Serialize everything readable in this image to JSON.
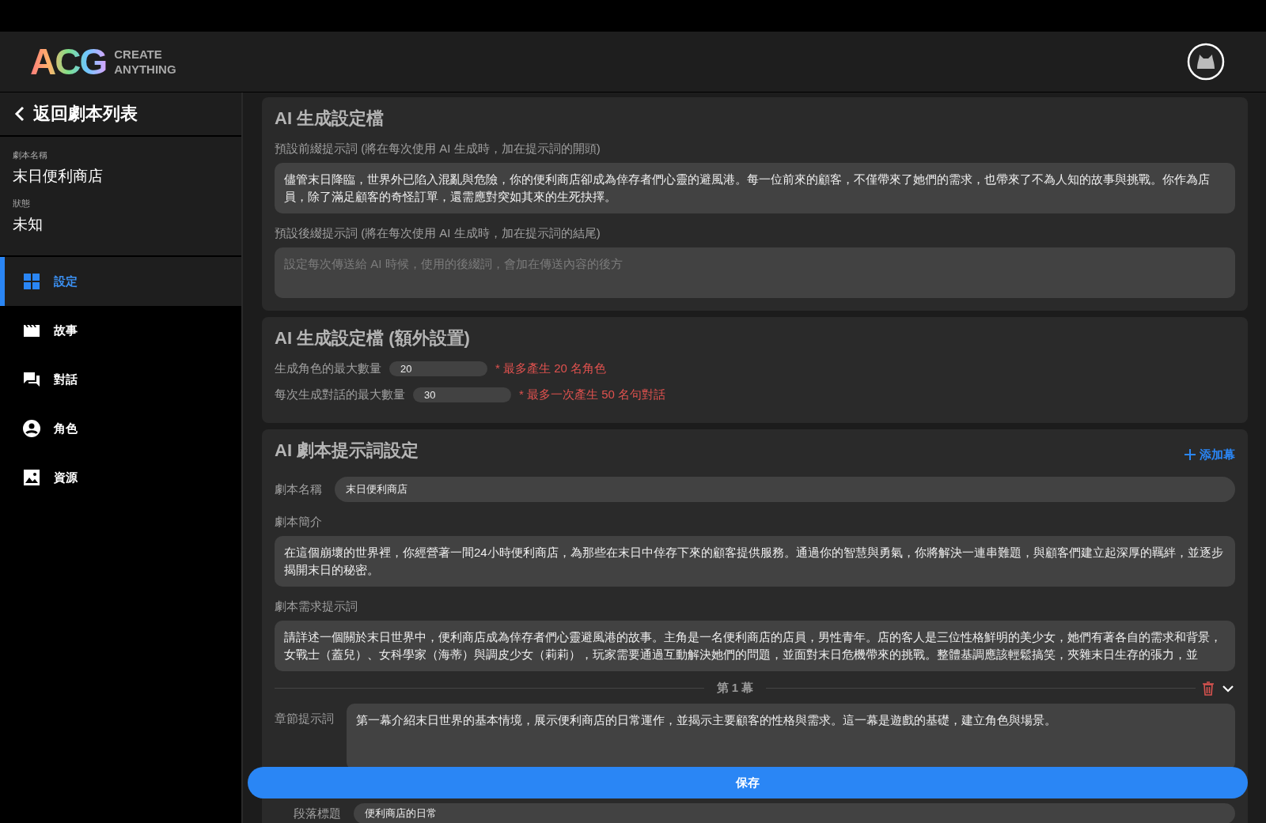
{
  "header": {
    "logo": "ACG",
    "tagline_1": "CREATE",
    "tagline_2": "ANYTHING"
  },
  "sidebar": {
    "back": "返回劇本列表",
    "info": [
      {
        "label": "劇本名稱",
        "value": "末日便利商店"
      },
      {
        "label": "狀態",
        "value": "未知"
      }
    ],
    "items": [
      {
        "kind": "grid",
        "label": "設定",
        "selected": true
      },
      {
        "kind": "film",
        "label": "故事",
        "selected": false
      },
      {
        "kind": "chat",
        "label": "對話",
        "selected": false
      },
      {
        "kind": "person",
        "label": "角色",
        "selected": false
      },
      {
        "kind": "image",
        "label": "資源",
        "selected": false
      }
    ]
  },
  "profile": {
    "title": "AI 生成設定檔",
    "prefix_label": "預設前綴提示詞 (將在每次使用 AI 生成時，加在提示詞的開頭)",
    "prefix_value": "儘管末日降臨，世界外已陷入混亂與危險，你的便利商店卻成為倖存者們心靈的避風港。每一位前來的顧客，不僅帶來了她們的需求，也帶來了不為人知的故事與挑戰。你作為店員，除了滿足顧客的奇怪訂單，還需應對突如其來的生死抉擇。",
    "suffix_label": "預設後綴提示詞 (將在每次使用 AI 生成時，加在提示詞的結尾)",
    "suffix_placeholder": "設定每次傳送給 AI 時候，使用的後綴詞，會加在傳送內容的後方"
  },
  "extra": {
    "title": "AI 生成設定檔 (額外設置)",
    "rows": [
      {
        "label": "生成角色的最大數量",
        "value": "20",
        "note": "* 最多產生 20 名角色"
      },
      {
        "label": "每次生成對話的最大數量",
        "value": "30",
        "note": "* 最多一次產生 50 名句對話"
      }
    ]
  },
  "script": {
    "title": "AI 劇本提示詞設定",
    "add": "添加幕",
    "name_label": "劇本名稱",
    "name_value": "末日便利商店",
    "intro_label": "劇本簡介",
    "intro_value": "在這個崩壞的世界裡，你經營著一間24小時便利商店，為那些在末日中倖存下來的顧客提供服務。通過你的智慧與勇氣，你將解決一連串難題，與顧客們建立起深厚的羈絆，並逐步揭開末日的秘密。",
    "req_label": "劇本需求提示詞",
    "req_value": "請詳述一個關於末日世界中，便利商店成為倖存者們心靈避風港的故事。主角是一名便利商店的店員，男性青年。店的客人是三位性格鮮明的美少女，她們有著各自的需求和背景，女戰士（蓋兒）、女科學家（海蒂）與調皮少女（莉莉），玩家需要通過互動解決她們的問題，並面對末日危機帶來的挑戰。整體基調應該輕鬆搞笑，夾雜末日生存的張力，並",
    "acts": [
      {
        "title": "第 1 幕",
        "expanded": true,
        "prompt_label": "章節提示詞",
        "prompt_value": "第一幕介紹末日世界的基本情境，展示便利商店的日常運作，並揭示主要顧客的性格與需求。這一幕是遊戲的基礎，建立角色與場景。",
        "section_label": "段落標題",
        "section_value": "便利商店的日常"
      }
    ]
  },
  "save": "保存"
}
